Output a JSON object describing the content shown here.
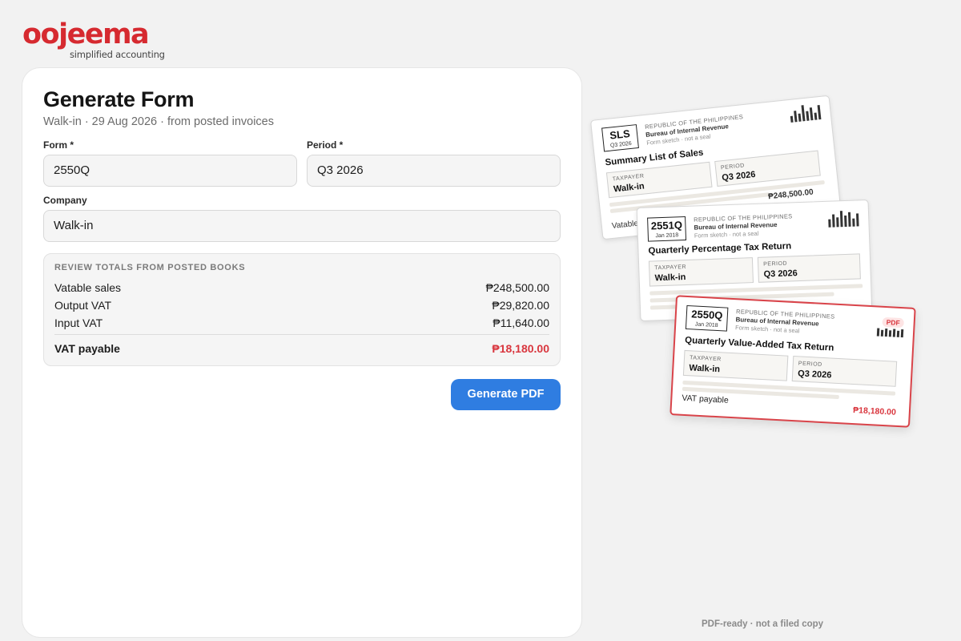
{
  "brand": {
    "name": "oojeema",
    "tagline": "simplified accounting",
    "color": "#d62a30"
  },
  "form_panel": {
    "title": "Generate Form",
    "subtitle": "Walk-in · 29 Aug 2026 · from posted invoices",
    "form_label": "Form *",
    "form_value": "2550Q",
    "period_label": "Period *",
    "period_value": "Q3 2026",
    "company_label": "Company",
    "company_value": "Walk-in",
    "review": {
      "heading": "REVIEW TOTALS FROM POSTED BOOKS",
      "rows": [
        {
          "label": "Vatable sales",
          "value": "₱248,500.00"
        },
        {
          "label": "Output VAT",
          "value": "₱29,820.00"
        },
        {
          "label": "Input VAT",
          "value": "₱11,640.00"
        }
      ],
      "total_label": "VAT payable",
      "total_value": "₱18,180.00"
    },
    "generate_label": "Generate PDF",
    "accent_color": "#2f7de1",
    "total_color": "#d9363e"
  },
  "previews": {
    "sls": {
      "code": "SLS",
      "code_date": "Q3 2026",
      "republic": "REPUBLIC OF THE PHILIPPINES",
      "bureau": "Bureau of Internal Revenue",
      "sketch": "Form sketch · not a seal",
      "title": "Summary List of Sales",
      "taxpayer_label": "TAXPAYER",
      "taxpayer_value": "Walk-in",
      "period_label": "PERIOD",
      "period_value": "Q3 2026",
      "amount": "₱248,500.00",
      "row_label": "Vatable sales"
    },
    "q2551": {
      "code": "2551Q",
      "code_date": "Jan 2018",
      "republic": "REPUBLIC OF THE PHILIPPINES",
      "bureau": "Bureau of Internal Revenue",
      "sketch": "Form sketch · not a seal",
      "title": "Quarterly Percentage Tax Return",
      "taxpayer_label": "TAXPAYER",
      "taxpayer_value": "Walk-in",
      "period_label": "PERIOD",
      "period_value": "Q3 2026"
    },
    "q2550": {
      "code": "2550Q",
      "code_date": "Jan 2018",
      "republic": "REPUBLIC OF THE PHILIPPINES",
      "bureau": "Bureau of Internal Revenue",
      "sketch": "Form sketch · not a seal",
      "badge": "PDF",
      "title": "Quarterly Value-Added Tax Return",
      "taxpayer_label": "TAXPAYER",
      "taxpayer_value": "Walk-in",
      "period_label": "PERIOD",
      "period_value": "Q3 2026",
      "payable_label": "VAT payable",
      "payable_value": "₱18,180.00"
    }
  },
  "footnote": "PDF-ready · not a filed copy"
}
